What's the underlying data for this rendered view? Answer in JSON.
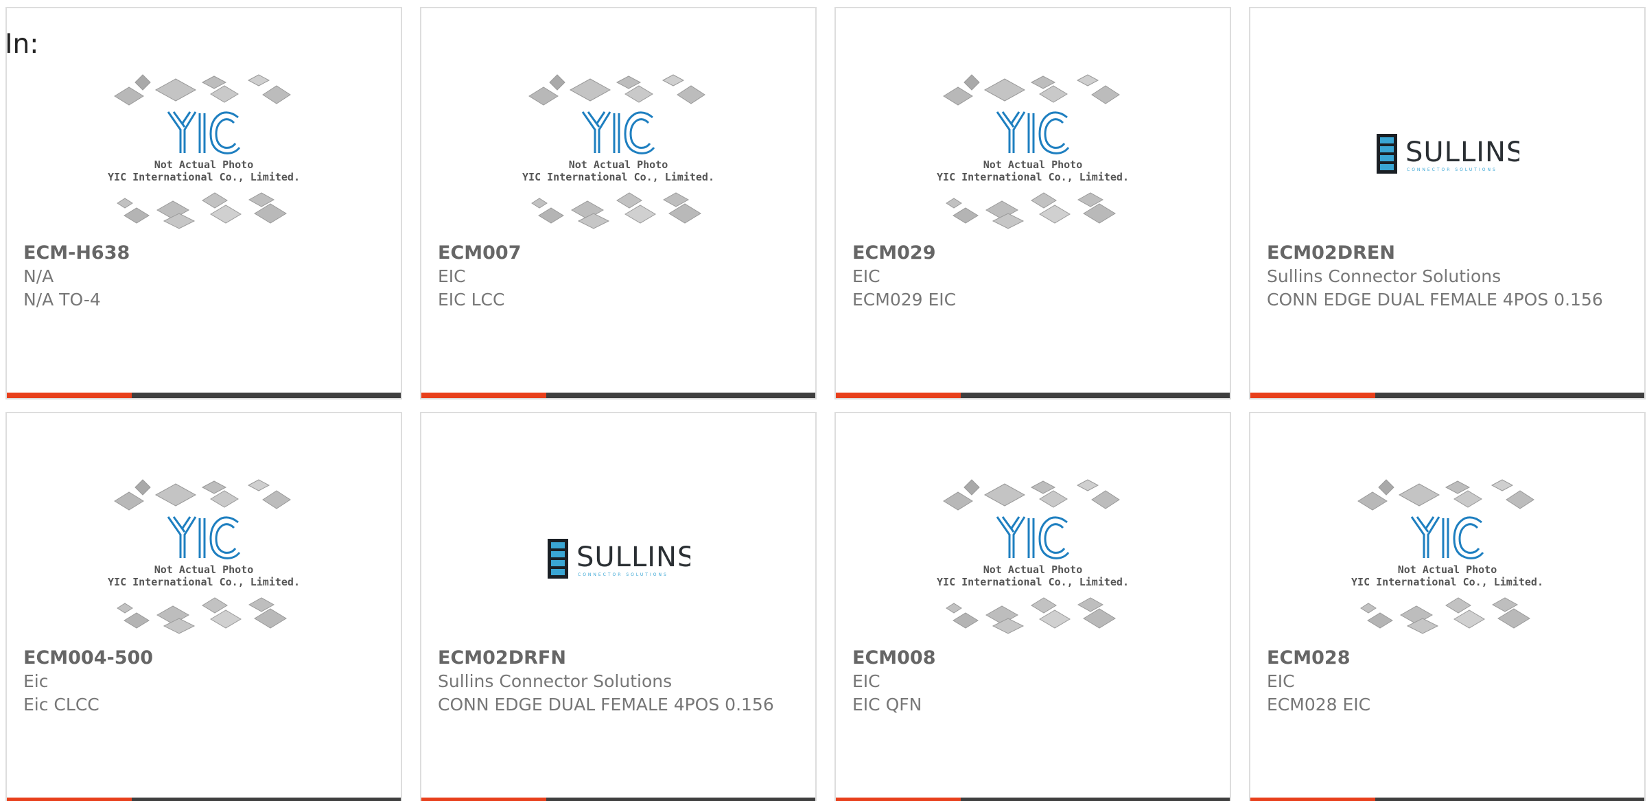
{
  "header": {
    "label": "In:"
  },
  "placeholder": {
    "logo_text": "YIC",
    "caption_line1": "Not Actual Photo",
    "caption_line2": "YIC International Co., Limited."
  },
  "sullins_logo": {
    "name": "SULLINS",
    "tagline": "CONNECTOR SOLUTIONS"
  },
  "colors": {
    "accent_red": "#e8401c",
    "bar_dark": "#3f3f3f",
    "yic_blue": "#1e7fc0",
    "sullins_blue": "#3aa6d4"
  },
  "products": [
    {
      "part_number": "ECM-H638",
      "manufacturer": "N/A",
      "description": "N/A TO-4",
      "image": "yic-placeholder"
    },
    {
      "part_number": "ECM007",
      "manufacturer": "EIC",
      "description": "EIC LCC",
      "image": "yic-placeholder"
    },
    {
      "part_number": "ECM029",
      "manufacturer": "EIC",
      "description": "ECM029 EIC",
      "image": "yic-placeholder"
    },
    {
      "part_number": "ECM02DREN",
      "manufacturer": "Sullins Connector Solutions",
      "description": "CONN EDGE DUAL FEMALE 4POS 0.156",
      "image": "sullins-logo"
    },
    {
      "part_number": "ECM004-500",
      "manufacturer": "Eic",
      "description": "Eic CLCC",
      "image": "yic-placeholder"
    },
    {
      "part_number": "ECM02DRFN",
      "manufacturer": "Sullins Connector Solutions",
      "description": "CONN EDGE DUAL FEMALE 4POS 0.156",
      "image": "sullins-logo"
    },
    {
      "part_number": "ECM008",
      "manufacturer": "EIC",
      "description": "EIC QFN",
      "image": "yic-placeholder"
    },
    {
      "part_number": "ECM028",
      "manufacturer": "EIC",
      "description": "ECM028 EIC",
      "image": "yic-placeholder"
    }
  ]
}
